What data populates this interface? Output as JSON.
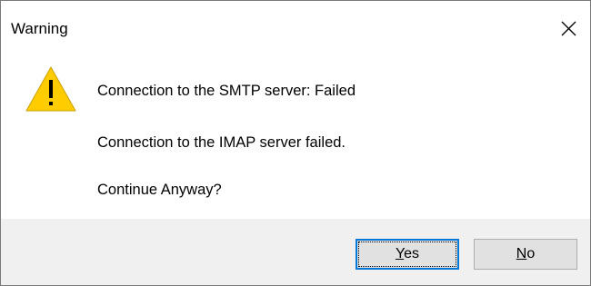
{
  "window": {
    "title": "Warning"
  },
  "icons": {
    "warning": "warning-triangle-icon",
    "close": "close-x-icon"
  },
  "colors": {
    "warning_fill": "#FFCC00",
    "accent_border": "#0078D7",
    "footer_bg": "#F0F0F0"
  },
  "messages": {
    "line1": "Connection to the SMTP server: Failed",
    "line2": "Connection to the IMAP server failed.",
    "line3": "Continue Anyway?"
  },
  "buttons": {
    "yes": {
      "mnemonic": "Y",
      "rest": "es"
    },
    "no": {
      "mnemonic": "N",
      "rest": "o"
    }
  }
}
